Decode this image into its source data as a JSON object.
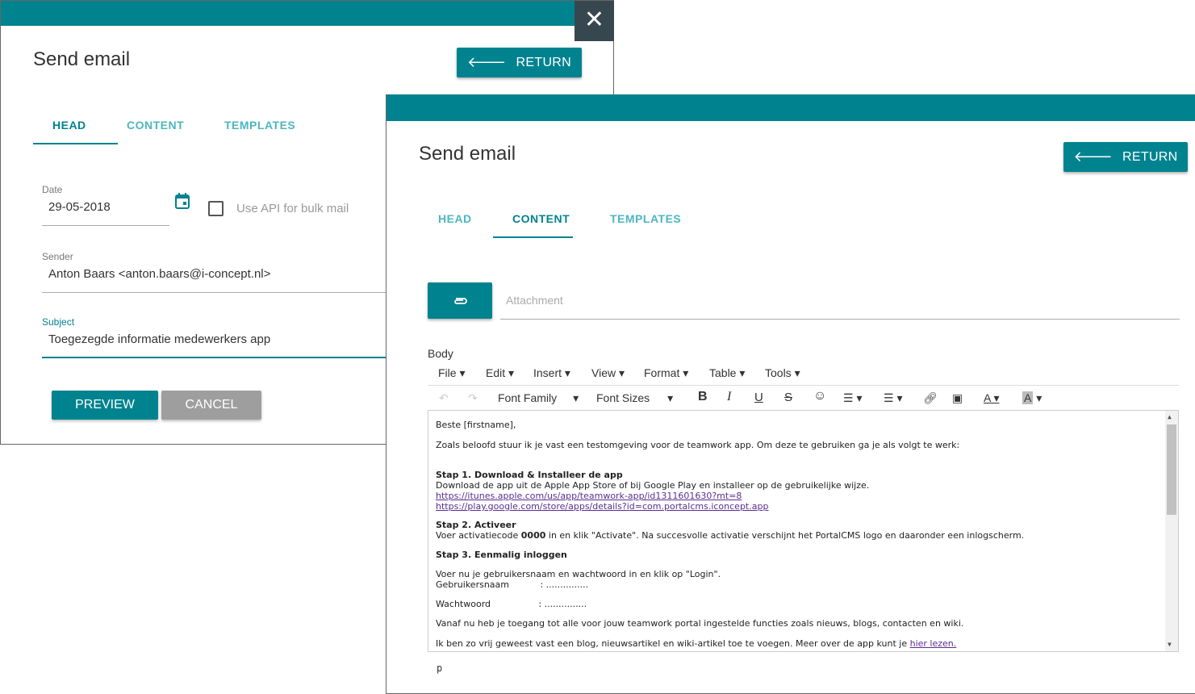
{
  "back_dialog": {
    "close_symbol": "✕",
    "title": "Send email",
    "return_label": "RETURN",
    "tabs": [
      "HEAD",
      "CONTENT",
      "TEMPLATES"
    ],
    "date_label": "Date",
    "date_value": "29-05-2018",
    "bulk_label": "Use API for bulk mail",
    "sender_label": "Sender",
    "sender_value": "Anton Baars <anton.baars@i-concept.nl>",
    "subject_label": "Subject",
    "subject_value": "Toegezegde informatie medewerkers app",
    "preview_label": "PREVIEW",
    "cancel_label": "CANCEL"
  },
  "front_dialog": {
    "title": "Send email",
    "return_label": "RETURN",
    "tabs": [
      "HEAD",
      "CONTENT",
      "TEMPLATES"
    ],
    "attachment_placeholder": "Attachment",
    "body_label": "Body",
    "menu": [
      "File",
      "Edit",
      "Insert",
      "View",
      "Format",
      "Table",
      "Tools"
    ],
    "font_family": "Font Family",
    "font_sizes": "Font Sizes",
    "status_path": "p",
    "body": {
      "greeting": "Beste [firstname],",
      "intro": "Zoals beloofd stuur ik je vast een testomgeving voor de teamwork app. Om deze te gebruiken ga je als volgt te werk:",
      "step1_title": "Stap 1. Download & Installeer de app",
      "step1_text": "Download de app uit de Apple App Store of bij Google Play en installeer op de gebruikelijke wijze.",
      "link1": "https://itunes.apple.com/us/app/teamwork-app/id1311601630?mt=8",
      "link2": "https://play.google.com/store/apps/details?id=com.portalcms.iconcept.app",
      "step2_title": "Stap 2. Activeer",
      "step2_pre": "Voer activatiecode ",
      "step2_code": "0000",
      "step2_post": "  in en klik \"Activate\". Na succesvolle activatie verschijnt het PortalCMS logo en daaronder een inlogscherm.",
      "step3_title": "Stap 3. Eenmalig inloggen",
      "step3_text": "Voer nu je gebruikersnaam en wachtwoord in en klik op \"Login\".",
      "username_line": "Gebruikersnaam           : ...............",
      "password_line": "Wachtwoord                 : ...............",
      "access_text": "Vanaf nu heb je toegang tot alle voor jouw teamwork portal ingestelde functies zoals nieuws, blogs, contacten en wiki.",
      "final_pre": "Ik ben zo vrij geweest vast een blog, nieuwsartikel en wiki-artikel toe te voegen. Meer over de app kunt je ",
      "final_link": "hier lezen."
    }
  },
  "colors": {
    "teal": "#00838f",
    "teal_light": "#4db6c0",
    "dark_close": "#37474f",
    "grey_button": "#9e9e9e"
  }
}
